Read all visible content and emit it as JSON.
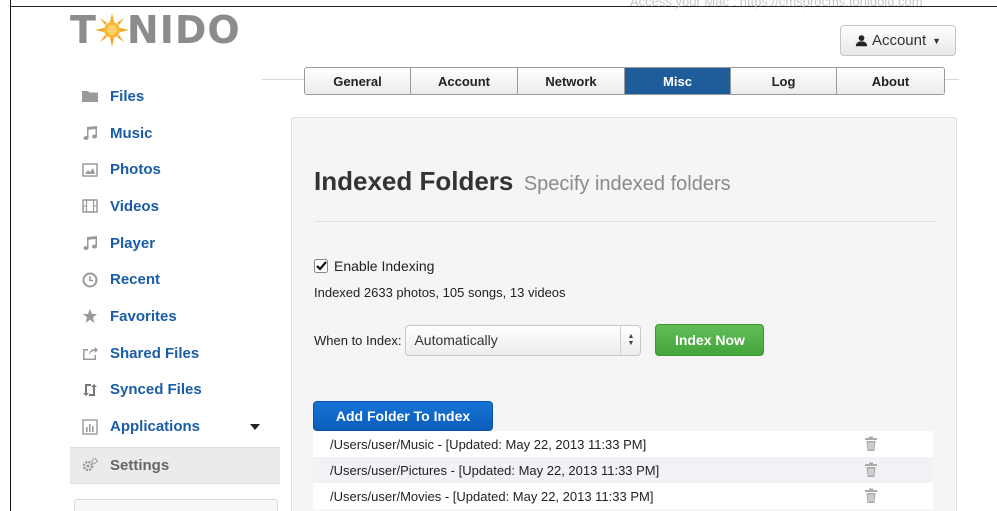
{
  "header": {
    "logo": "TONIDO",
    "top_url_text": "Access your Mac : https://cmsprocms.tonidoid.com",
    "account_label": "Account"
  },
  "tabs": [
    {
      "label": "General",
      "active": false
    },
    {
      "label": "Account",
      "active": false
    },
    {
      "label": "Network",
      "active": false
    },
    {
      "label": "Misc",
      "active": true
    },
    {
      "label": "Log",
      "active": false
    },
    {
      "label": "About",
      "active": false
    }
  ],
  "sidebar": {
    "items": [
      {
        "label": "Files",
        "icon": "folder-icon"
      },
      {
        "label": "Music",
        "icon": "music-icon"
      },
      {
        "label": "Photos",
        "icon": "photo-icon"
      },
      {
        "label": "Videos",
        "icon": "film-icon"
      },
      {
        "label": "Player",
        "icon": "music-icon"
      },
      {
        "label": "Recent",
        "icon": "clock-icon"
      },
      {
        "label": "Favorites",
        "icon": "star-icon"
      },
      {
        "label": "Shared Files",
        "icon": "share-icon"
      },
      {
        "label": "Synced Files",
        "icon": "sync-icon"
      },
      {
        "label": "Applications",
        "icon": "chart-icon"
      },
      {
        "label": "Settings",
        "icon": "gear-icon"
      }
    ]
  },
  "main": {
    "title": "Indexed Folders",
    "subtitle": "Specify indexed folders",
    "enable_label": "Enable Indexing",
    "enable_checked": true,
    "stats": "Indexed 2633 photos, 105 songs, 13 videos",
    "when_label": "When to Index:",
    "when_value": "Automatically",
    "index_now_label": "Index Now",
    "add_folder_label": "Add Folder To Index",
    "folders": [
      "/Users/user/Music - [Updated: May 22, 2013 11:33 PM]",
      "/Users/user/Pictures - [Updated: May 22, 2013 11:33 PM]",
      "/Users/user/Movies - [Updated: May 22, 2013 11:33 PM]"
    ]
  },
  "colors": {
    "active_tab": "#1e5c9a",
    "link": "#1a5da6",
    "index_button": "#4cae42",
    "add_button": "#0e63c4"
  }
}
